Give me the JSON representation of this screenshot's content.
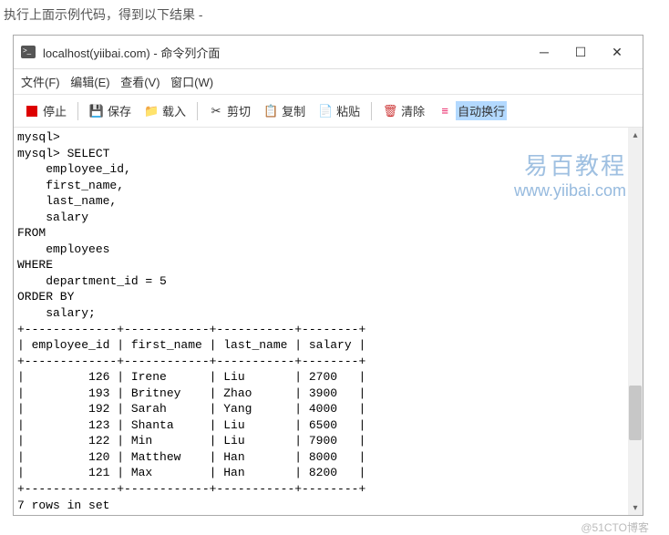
{
  "intro": "执行上面示例代码，得到以下结果 -",
  "window": {
    "title": "localhost(yiibai.com) - 命令列介面"
  },
  "menu": {
    "file": "文件(F)",
    "edit": "编辑(E)",
    "view": "查看(V)",
    "window": "窗口(W)"
  },
  "toolbar": {
    "stop": "停止",
    "save": "保存",
    "load": "载入",
    "cut": "剪切",
    "copy": "复制",
    "paste": "粘贴",
    "clear": "清除",
    "auto": "自动换行"
  },
  "watermark": {
    "line1": "易百教程",
    "line2": "www.yiibai.com"
  },
  "terminal": {
    "prompt": "mysql>",
    "query_lines": [
      "mysql>",
      "mysql> SELECT",
      "    employee_id,",
      "    first_name,",
      "    last_name,",
      "    salary",
      "FROM",
      "    employees",
      "WHERE",
      "    department_id = 5",
      "ORDER BY",
      "    salary;"
    ],
    "sep": "+-------------+------------+-----------+--------+",
    "header": "| employee_id | first_name | last_name | salary |",
    "rows": [
      "|         126 | Irene      | Liu       | 2700   |",
      "|         193 | Britney    | Zhao      | 3900   |",
      "|         192 | Sarah      | Yang      | 4000   |",
      "|         123 | Shanta     | Liu       | 6500   |",
      "|         122 | Min        | Liu       | 7900   |",
      "|         120 | Matthew    | Han       | 8000   |",
      "|         121 | Max        | Han       | 8200   |"
    ],
    "footer": "7 rows in set"
  },
  "bottom_watermark": "@51CTO博客"
}
